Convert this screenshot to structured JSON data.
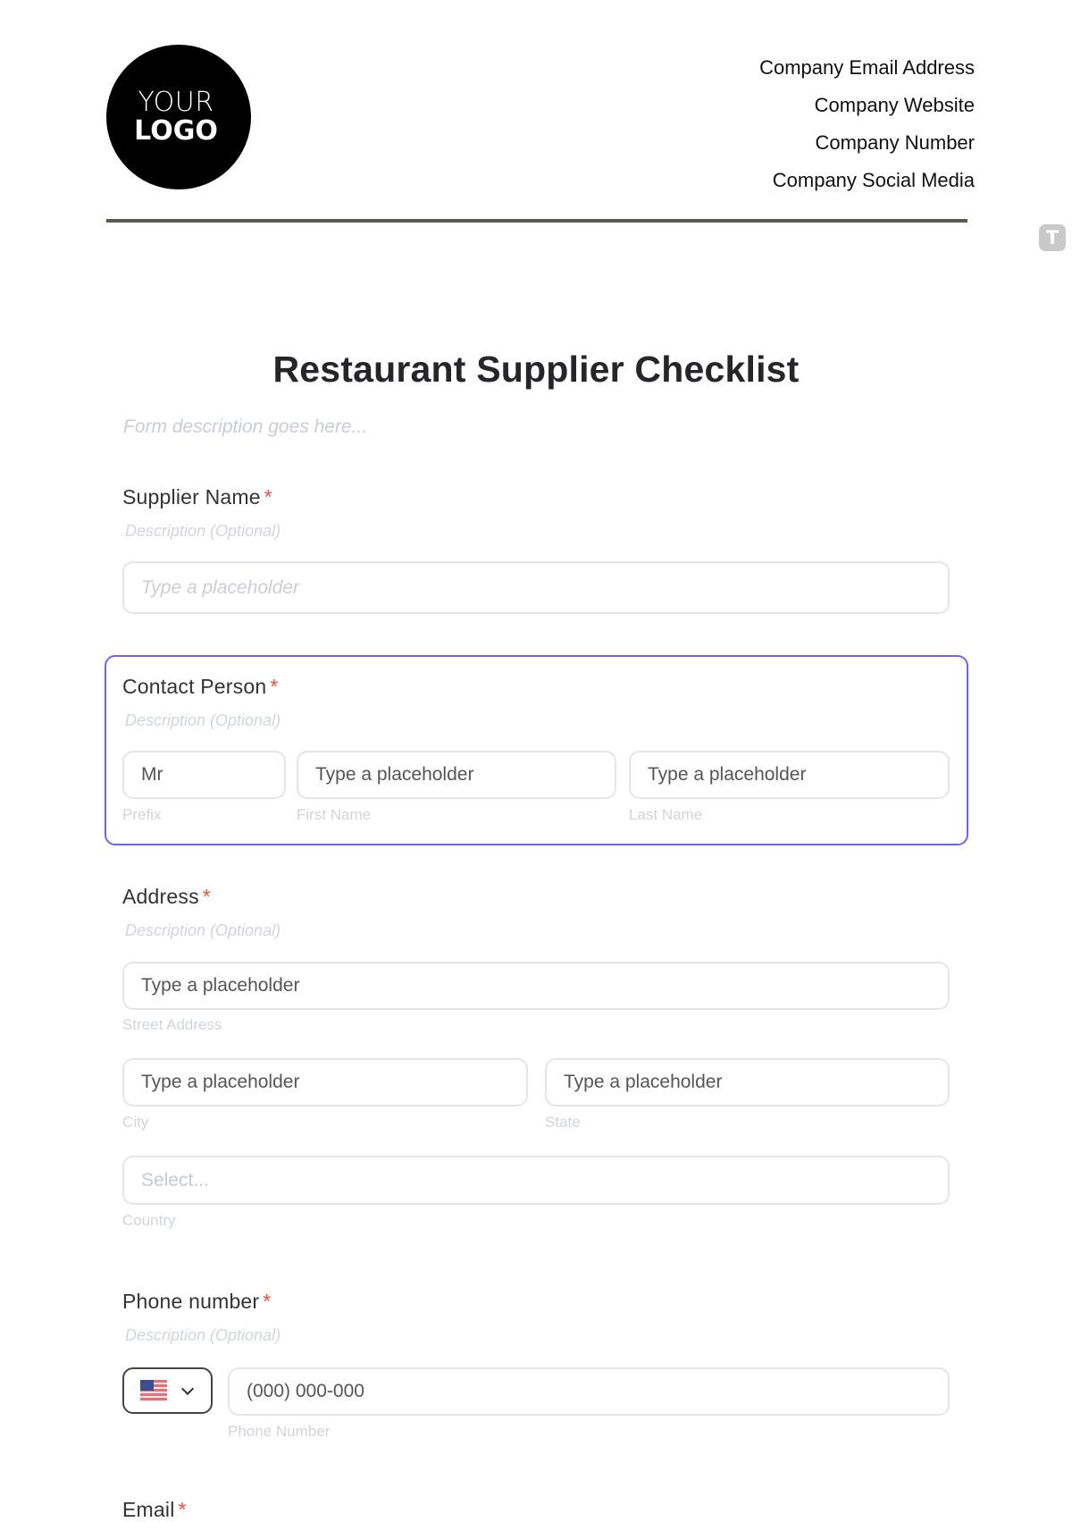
{
  "header": {
    "logo": {
      "line1": "YOUR",
      "line2": "LOGO"
    },
    "company_info": [
      "Company Email Address",
      "Company Website",
      "Company Number",
      "Company Social Media"
    ],
    "badge_letter": "T"
  },
  "form": {
    "title": "Restaurant Supplier Checklist",
    "description_placeholder": "Form description goes here...",
    "required_marker": "*",
    "fields": {
      "supplier_name": {
        "label": "Supplier Name",
        "description": "Description (Optional)",
        "placeholder": "Type a placeholder"
      },
      "contact_person": {
        "label": "Contact Person",
        "description": "Description (Optional)",
        "prefix_value": "Mr",
        "prefix_sublabel": "Prefix",
        "first_name_placeholder": "Type a placeholder",
        "first_name_sublabel": "First Name",
        "last_name_placeholder": "Type a placeholder",
        "last_name_sublabel": "Last Name"
      },
      "address": {
        "label": "Address",
        "description": "Description (Optional)",
        "street_placeholder": "Type a placeholder",
        "street_sublabel": "Street Address",
        "city_placeholder": "Type a placeholder",
        "city_sublabel": "City",
        "state_placeholder": "Type a placeholder",
        "state_sublabel": "State",
        "country_placeholder": "Select...",
        "country_sublabel": "Country"
      },
      "phone": {
        "label": "Phone number",
        "description": "Description (Optional)",
        "country_flag": "us-flag-icon",
        "placeholder": "(000) 000-000",
        "sublabel": "Phone Number"
      },
      "email": {
        "label": "Email"
      }
    }
  },
  "colors": {
    "selected_border": "#6c63f6",
    "required": "#f24b3f",
    "header_rule": "#5a5a4a"
  }
}
